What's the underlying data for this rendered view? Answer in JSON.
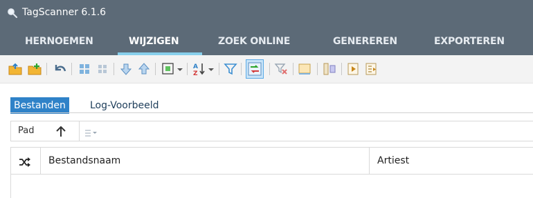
{
  "window": {
    "title": "TagScanner 6.1.6"
  },
  "menu": {
    "items": [
      {
        "label": "HERNOEMEN"
      },
      {
        "label": "WIJZIGEN"
      },
      {
        "label": "ZOEK ONLINE"
      },
      {
        "label": "GENEREREN"
      },
      {
        "label": "EXPORTEREN"
      }
    ],
    "active": "WIJZIGEN"
  },
  "toolbar": {
    "icons": [
      "open-folder-icon",
      "add-folder-icon",
      "undo-icon",
      "grid-icon",
      "grid-small-icon",
      "move-down-icon",
      "move-up-icon",
      "select-frame-icon",
      "sort-az-icon",
      "filter-icon",
      "swap-tag-icon",
      "clear-filter-icon",
      "panel-icon",
      "split-icon",
      "play-icon",
      "playlist-icon"
    ]
  },
  "tabs": [
    {
      "label": "Bestanden"
    },
    {
      "label": "Log-Voorbeeld"
    }
  ],
  "pathbar": {
    "label": "Pad",
    "value": ""
  },
  "table": {
    "columns": [
      {
        "label": "Bestandsnaam"
      },
      {
        "label": "Artiest"
      }
    ],
    "rows": []
  },
  "colors": {
    "header_bg": "#5c6a77",
    "active_underline": "#87cfeb",
    "tab_active_bg": "#2f82c8",
    "toolbar_bg": "#f3f3f3"
  }
}
